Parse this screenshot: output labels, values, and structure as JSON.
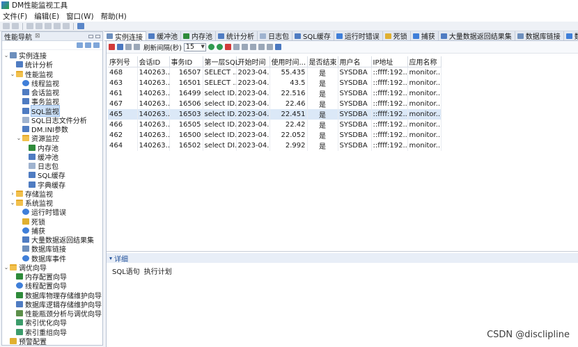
{
  "app": {
    "title": "DM性能监视工具"
  },
  "menu": [
    "文件(F)",
    "编辑(E)",
    "窗口(W)",
    "帮助(H)"
  ],
  "left_panel": {
    "title": "性能导航",
    "close": "⊠"
  },
  "tree": [
    {
      "label": "实例连接",
      "level": 0,
      "exp": "⌄",
      "icon": "db",
      "name": "tree-instance-connection"
    },
    {
      "label": "统计分析",
      "level": 1,
      "exp": "",
      "icon": "grid",
      "name": "tree-stat-analysis"
    },
    {
      "label": "性能监视",
      "level": 1,
      "exp": "⌄",
      "icon": "folder",
      "name": "tree-perf-monitor"
    },
    {
      "label": "线程监视",
      "level": 2,
      "exp": "",
      "icon": "gear",
      "name": "tree-thread-monitor"
    },
    {
      "label": "会话监视",
      "level": 2,
      "exp": "",
      "icon": "grid",
      "name": "tree-session-monitor"
    },
    {
      "label": "事务监视",
      "level": 2,
      "exp": "",
      "icon": "grid",
      "name": "tree-transaction-monitor"
    },
    {
      "label": "SQL监视",
      "level": 2,
      "exp": "",
      "icon": "grid",
      "name": "tree-sql-monitor",
      "selected": true
    },
    {
      "label": "SQL日志文件分析",
      "level": 2,
      "exp": "",
      "icon": "doc",
      "name": "tree-sql-log-analysis"
    },
    {
      "label": "DM.INI参数",
      "level": 2,
      "exp": "",
      "icon": "grid",
      "name": "tree-dm-ini-params"
    },
    {
      "label": "资源监控",
      "level": 2,
      "exp": "⌄",
      "icon": "folder",
      "name": "tree-resource-monitor"
    },
    {
      "label": "内存池",
      "level": 3,
      "exp": "",
      "icon": "green",
      "name": "tree-memory-pool"
    },
    {
      "label": "缓冲池",
      "level": 3,
      "exp": "",
      "icon": "grid",
      "name": "tree-buffer-pool"
    },
    {
      "label": "日志包",
      "level": 3,
      "exp": "",
      "icon": "doc",
      "name": "tree-log-package"
    },
    {
      "label": "SQL缓存",
      "level": 3,
      "exp": "",
      "icon": "grid",
      "name": "tree-sql-cache"
    },
    {
      "label": "字典缓存",
      "level": 3,
      "exp": "",
      "icon": "grid",
      "name": "tree-dict-cache"
    },
    {
      "label": "存储监视",
      "level": 1,
      "exp": "›",
      "icon": "folder",
      "name": "tree-storage-monitor"
    },
    {
      "label": "系统监视",
      "level": 1,
      "exp": "⌄",
      "icon": "folder",
      "name": "tree-system-monitor"
    },
    {
      "label": "运行时错误",
      "level": 2,
      "exp": "",
      "icon": "gear",
      "name": "tree-runtime-error"
    },
    {
      "label": "死锁",
      "level": 2,
      "exp": "",
      "icon": "lock",
      "name": "tree-deadlock"
    },
    {
      "label": "捕获",
      "level": 2,
      "exp": "",
      "icon": "gear",
      "name": "tree-capture"
    },
    {
      "label": "大量数据返回结果集",
      "level": 2,
      "exp": "",
      "icon": "grid",
      "name": "tree-large-resultset"
    },
    {
      "label": "数据库链接",
      "level": 2,
      "exp": "",
      "icon": "db",
      "name": "tree-db-link"
    },
    {
      "label": "数据库事件",
      "level": 2,
      "exp": "",
      "icon": "gear",
      "name": "tree-db-event"
    },
    {
      "label": "调优向导",
      "level": 0,
      "exp": "⌄",
      "icon": "folder",
      "name": "tree-tuning-wizard"
    },
    {
      "label": "内存配置向导",
      "level": 1,
      "exp": "",
      "icon": "green",
      "name": "tree-memory-config-wizard"
    },
    {
      "label": "线程配置向导",
      "level": 1,
      "exp": "",
      "icon": "gear",
      "name": "tree-thread-config-wizard"
    },
    {
      "label": "数据库物理存储维护向导",
      "level": 1,
      "exp": "",
      "icon": "green",
      "name": "tree-physical-storage-wizard"
    },
    {
      "label": "数据库逻辑存储维护向导",
      "level": 1,
      "exp": "",
      "icon": "grid",
      "name": "tree-logical-storage-wizard"
    },
    {
      "label": "性能瓶颈分析与调优向导",
      "level": 1,
      "exp": "",
      "icon": "chart",
      "name": "tree-bottleneck-wizard"
    },
    {
      "label": "索引优化向导",
      "level": 1,
      "exp": "",
      "icon": "tree-i",
      "name": "tree-index-optimize-wizard"
    },
    {
      "label": "索引重组向导",
      "level": 1,
      "exp": "",
      "icon": "tree-i",
      "name": "tree-index-reorg-wizard"
    },
    {
      "label": "预警配置",
      "level": 0,
      "exp": "",
      "icon": "lock",
      "name": "tree-alert-config"
    }
  ],
  "tabs": [
    {
      "label": "实例连接",
      "icon": "db",
      "active": true
    },
    {
      "label": "缓冲池",
      "icon": "grid"
    },
    {
      "label": "内存池",
      "icon": "green"
    },
    {
      "label": "统计分析",
      "icon": "grid"
    },
    {
      "label": "日志包",
      "icon": "doc"
    },
    {
      "label": "SQL缓存",
      "icon": "grid"
    },
    {
      "label": "运行时错误",
      "icon": "gear"
    },
    {
      "label": "死锁",
      "icon": "lock"
    },
    {
      "label": "捕获",
      "icon": "gear"
    },
    {
      "label": "大量数据返回结果集",
      "icon": "grid"
    },
    {
      "label": "数据库链接",
      "icon": "db"
    },
    {
      "label": "数据",
      "icon": "gear"
    }
  ],
  "content_toolbar": {
    "interval_label": "刷新间隔(秒)",
    "interval_value": "15"
  },
  "table": {
    "columns": [
      "序列号",
      "会话ID",
      "事务ID",
      "第一层SQL",
      "开始时间",
      "使用时间...",
      "是否结束",
      "用户名",
      "IP地址",
      "应用名称"
    ],
    "rows": [
      [
        "468",
        "140263...",
        "16507",
        "SELECT ...",
        "2023-04...",
        "55.435",
        "是",
        "SYSDBA",
        "::ffff:192....",
        "monitor...."
      ],
      [
        "463",
        "140263...",
        "16501",
        "SELECT ...",
        "2023-04...",
        "43.5",
        "是",
        "SYSDBA",
        "::ffff:192....",
        "monitor...."
      ],
      [
        "461",
        "140263...",
        "16499",
        "select ID...",
        "2023-04...",
        "22.516",
        "是",
        "SYSDBA",
        "::ffff:192....",
        "monitor...."
      ],
      [
        "467",
        "140263...",
        "16506",
        "select ID...",
        "2023-04...",
        "22.46",
        "是",
        "SYSDBA",
        "::ffff:192....",
        "monitor...."
      ],
      [
        "465",
        "140263...",
        "16503",
        "select ID...",
        "2023-04...",
        "22.451",
        "是",
        "SYSDBA",
        "::ffff:192....",
        "monitor...."
      ],
      [
        "466",
        "140263...",
        "16505",
        "select ID...",
        "2023-04...",
        "22.42",
        "是",
        "SYSDBA",
        "::ffff:192....",
        "monitor...."
      ],
      [
        "462",
        "140263...",
        "16500",
        "select ID...",
        "2023-04...",
        "22.052",
        "是",
        "SYSDBA",
        "::ffff:192....",
        "monitor...."
      ],
      [
        "464",
        "140263...",
        "16502",
        "select DI...",
        "2023-04...",
        "2.992",
        "是",
        "SYSDBA",
        "::ffff:192....",
        "monitor...."
      ]
    ],
    "selected_row": 4
  },
  "detail": {
    "title": "详细",
    "tabs": [
      "SQL语句",
      "执行计划"
    ]
  },
  "watermark": "CSDN @disclipline"
}
